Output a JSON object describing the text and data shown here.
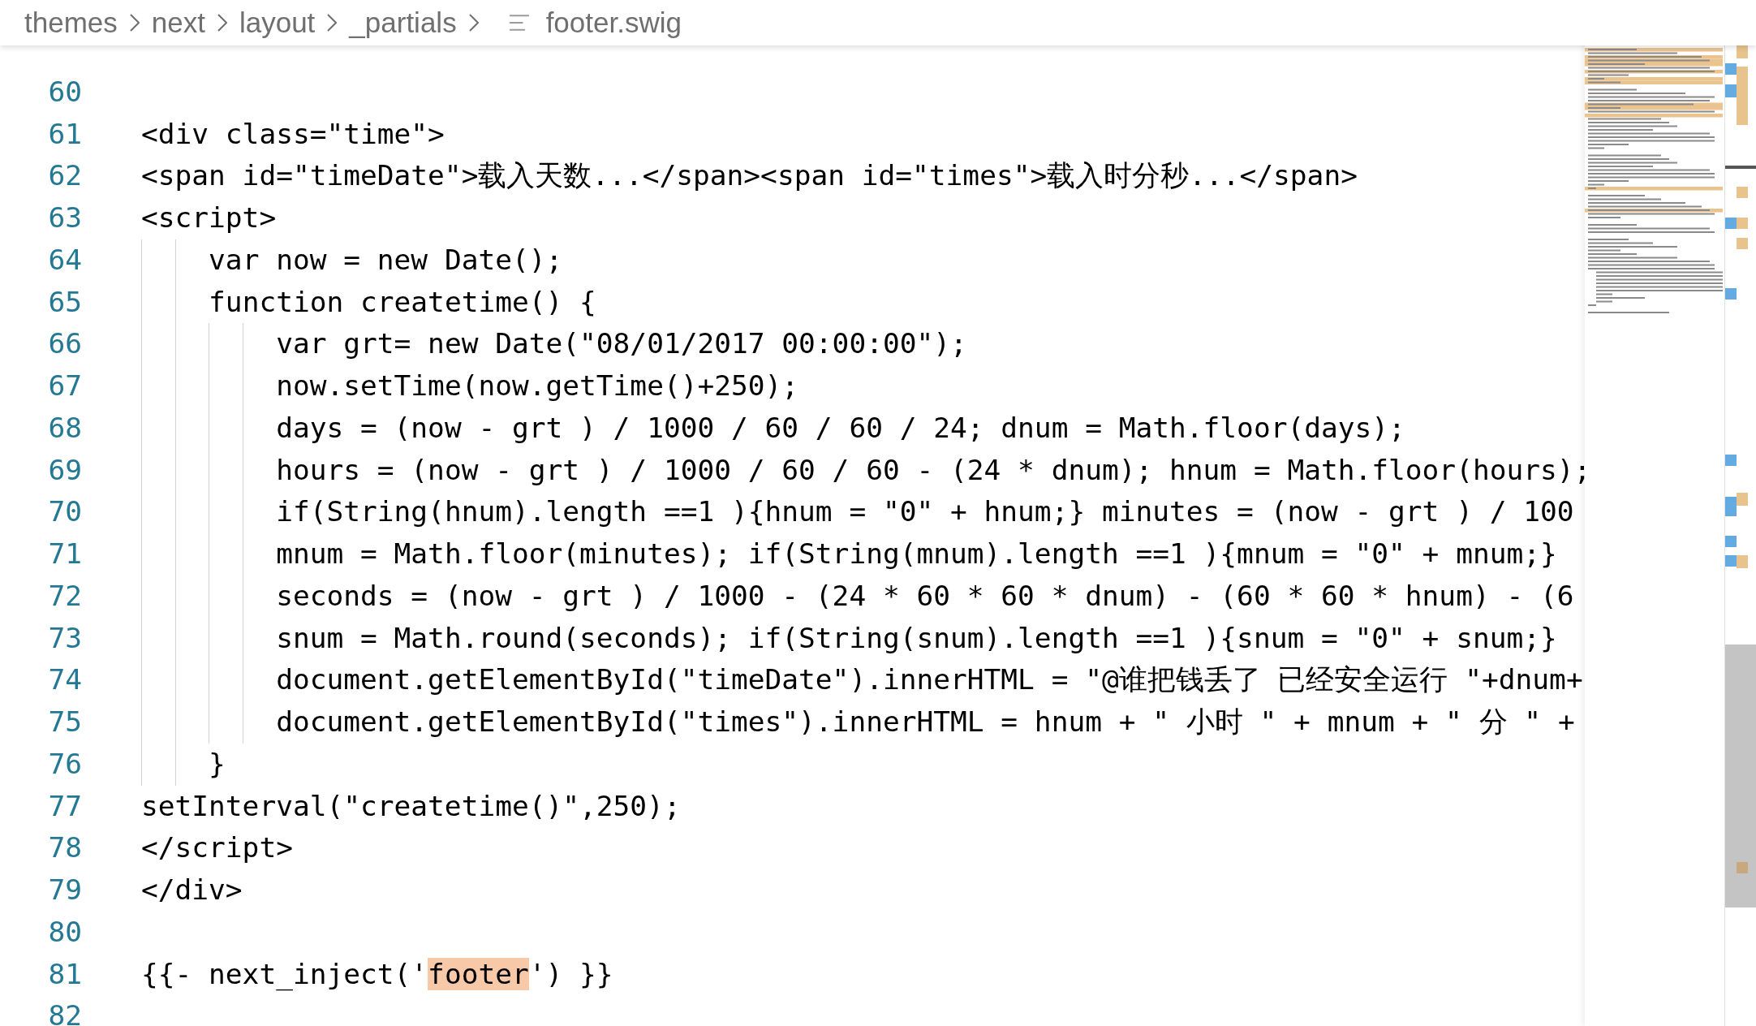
{
  "breadcrumb": {
    "folders": [
      "themes",
      "next",
      "layout",
      "_partials"
    ],
    "file": "footer.swig"
  },
  "editor": {
    "lines": [
      {
        "number": "60"
      },
      {
        "number": "61",
        "text": "<div class=\"time\">"
      },
      {
        "number": "62",
        "text": "<span id=\"timeDate\">载入天数...</span><span id=\"times\">载入时分秒...</span>"
      },
      {
        "number": "63",
        "text": "<script>"
      },
      {
        "number": "64",
        "text": "    var now = new Date();"
      },
      {
        "number": "65",
        "text": "    function createtime() {"
      },
      {
        "number": "66",
        "text": "        var grt= new Date(\"08/01/2017 00:00:00\");"
      },
      {
        "number": "67",
        "text": "        now.setTime(now.getTime()+250);"
      },
      {
        "number": "68",
        "text": "        days = (now - grt ) / 1000 / 60 / 60 / 24; dnum = Math.floor(days);"
      },
      {
        "number": "69",
        "text": "        hours = (now - grt ) / 1000 / 60 / 60 - (24 * dnum); hnum = Math.floor(hours);"
      },
      {
        "number": "70",
        "text": "        if(String(hnum).length ==1 ){hnum = \"0\" + hnum;} minutes = (now - grt ) / 100"
      },
      {
        "number": "71",
        "text": "        mnum = Math.floor(minutes); if(String(mnum).length ==1 ){mnum = \"0\" + mnum;}"
      },
      {
        "number": "72",
        "text": "        seconds = (now - grt ) / 1000 - (24 * 60 * 60 * dnum) - (60 * 60 * hnum) - (6"
      },
      {
        "number": "73",
        "text": "        snum = Math.round(seconds); if(String(snum).length ==1 ){snum = \"0\" + snum;}"
      },
      {
        "number": "74",
        "text": "        document.getElementById(\"timeDate\").innerHTML = \"@谁把钱丢了 已经安全运行 \"+dnum+"
      },
      {
        "number": "75",
        "text": "        document.getElementById(\"times\").innerHTML = hnum + \" 小时 \" + mnum + \" 分 \" +"
      },
      {
        "number": "76",
        "text": "    }"
      },
      {
        "number": "77",
        "text": "setInterval(\"createtime()\",250);"
      },
      {
        "number": "78",
        "text": "</script>"
      },
      {
        "number": "79",
        "text": "</div>"
      },
      {
        "number": "80"
      },
      {
        "number": "81",
        "segments": [
          {
            "text": "{{- next_inject('",
            "highlighted": false
          },
          {
            "text": "footer",
            "highlighted": true
          },
          {
            "text": "') }}",
            "highlighted": false
          }
        ]
      },
      {
        "number": "82"
      }
    ]
  }
}
